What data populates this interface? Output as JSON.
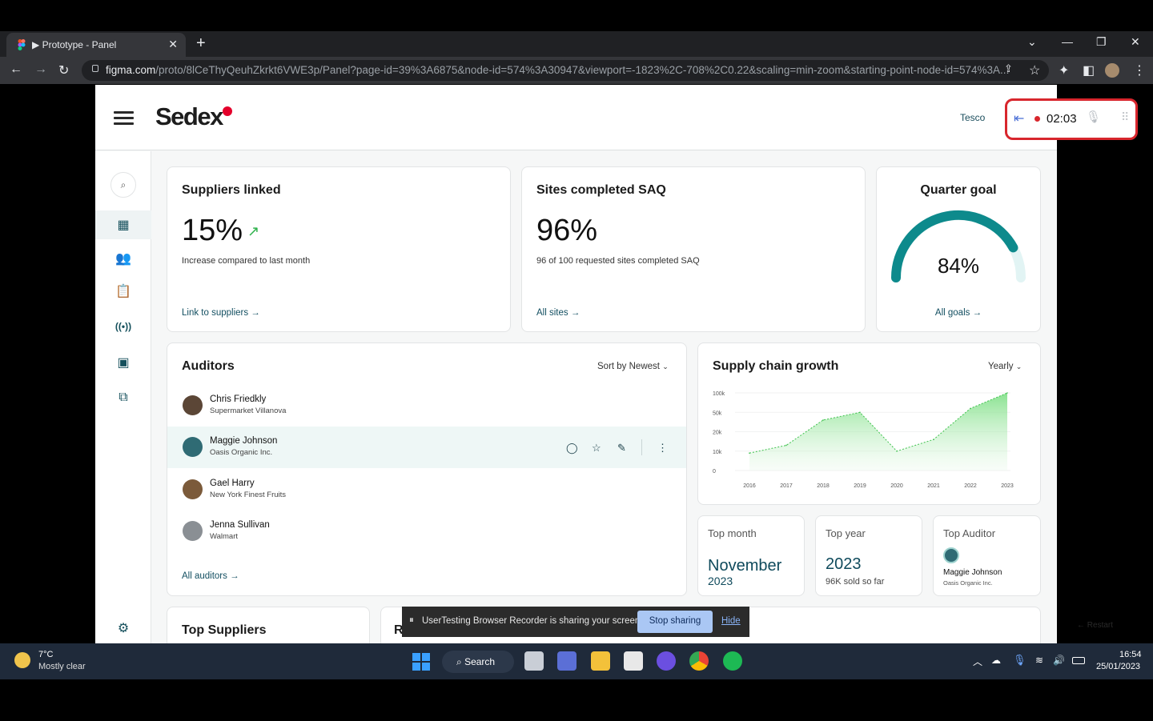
{
  "browser": {
    "tab_title": "▶ Prototype - Panel",
    "url_host": "figma.com",
    "url_path": "/proto/8lCeThyQeuhZkrkt6VWE3p/Panel?page-id=39%3A6875&node-id=574%3A30947&viewport=-1823%2C-708%2C0.22&scaling=min-zoom&starting-point-node-id=574%3A...",
    "new_tab": "+",
    "close": "✕"
  },
  "header": {
    "logo": "Sedex",
    "account": "Tesco"
  },
  "recorder": {
    "time": "02:03"
  },
  "cards": {
    "suppliers": {
      "title": "Suppliers linked",
      "value": "15%",
      "caption": "Increase compared to last month",
      "link": "Link to suppliers →"
    },
    "saq": {
      "title": "Sites completed SAQ",
      "value": "96%",
      "caption": "96 of 100 requested sites completed SAQ",
      "link": "All sites →"
    },
    "goal": {
      "title": "Quarter goal",
      "value": "84%",
      "percent": 84,
      "link": "All goals →"
    }
  },
  "auditors": {
    "title": "Auditors",
    "sort": "Sort by Newest",
    "items": [
      {
        "name": "Chris Friedkly",
        "org": "Supermarket Villanova",
        "color": "#5b4636"
      },
      {
        "name": "Maggie Johnson",
        "org": "Oasis Organic Inc.",
        "color": "#2f6b74"
      },
      {
        "name": "Gael Harry",
        "org": "New York Finest Fruits",
        "color": "#7b5a3a"
      },
      {
        "name": "Jenna Sullivan",
        "org": "Walmart",
        "color": "#8a8f94"
      }
    ],
    "link": "All auditors →"
  },
  "chart_data": {
    "type": "area",
    "title": "Supply chain growth",
    "filter": "Yearly",
    "x": [
      "2016",
      "2017",
      "2018",
      "2019",
      "2020",
      "2021",
      "2022",
      "2023"
    ],
    "y_ticks": [
      "100k",
      "50k",
      "20k",
      "10k",
      "0"
    ],
    "values": [
      0.9,
      1.3,
      2.6,
      3.0,
      1.0,
      1.6,
      3.2,
      4.0
    ]
  },
  "stats": {
    "top_month": {
      "label": "Top month",
      "value": "November",
      "sub": "2023"
    },
    "top_year": {
      "label": "Top year",
      "value": "2023",
      "sub": "96K sold so far"
    },
    "top_auditor": {
      "label": "Top Auditor",
      "name": "Maggie Johnson",
      "org": "Oasis Organic Inc."
    }
  },
  "bottom": {
    "top_suppliers": "Top Suppliers",
    "partial": "R"
  },
  "share_bar": {
    "text": "UserTesting Browser Recorder is sharing your screen.",
    "stop": "Stop sharing",
    "hide": "Hide"
  },
  "taskbar": {
    "temp": "7°C",
    "weather": "Mostly clear",
    "search": "Search",
    "time": "16:54",
    "date": "25/01/2023"
  },
  "background_text": "Restart"
}
